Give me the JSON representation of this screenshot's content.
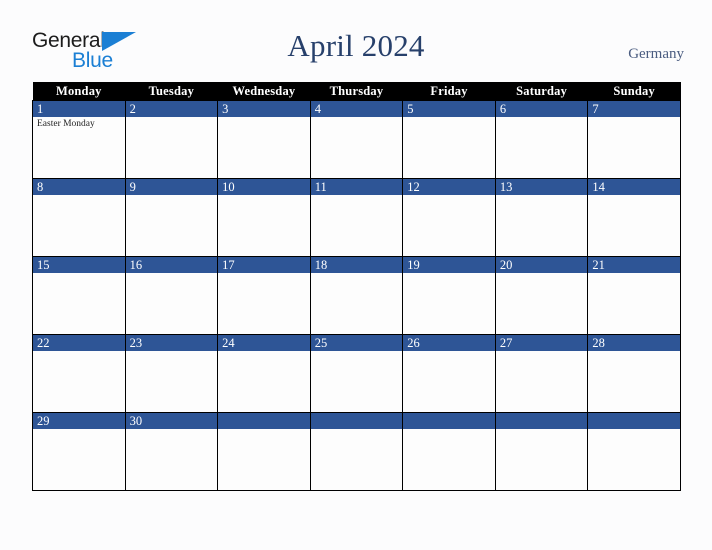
{
  "brand": {
    "name_part1": "General",
    "name_part2": "Blue",
    "color_dark": "#1c1c1c",
    "color_blue": "#1b7fd4"
  },
  "header": {
    "title": "April 2024",
    "region": "Germany",
    "title_color": "#27406b",
    "region_color": "#4a5c80"
  },
  "calendar": {
    "month": "April",
    "year": "2024",
    "country": "Germany",
    "weekday_headers": [
      "Monday",
      "Tuesday",
      "Wednesday",
      "Thursday",
      "Friday",
      "Saturday",
      "Sunday"
    ],
    "header_bg": "#000000",
    "header_text_color": "#ffffff",
    "date_band_color": "#2e5596",
    "date_text_color": "#ffffff",
    "cell_bg": "#fdfdfd",
    "cell_border_color": "#000000",
    "weeks": [
      {
        "days": [
          {
            "date": "1",
            "events": [
              "Easter Monday"
            ]
          },
          {
            "date": "2",
            "events": []
          },
          {
            "date": "3",
            "events": []
          },
          {
            "date": "4",
            "events": []
          },
          {
            "date": "5",
            "events": []
          },
          {
            "date": "6",
            "events": []
          },
          {
            "date": "7",
            "events": []
          }
        ]
      },
      {
        "days": [
          {
            "date": "8",
            "events": []
          },
          {
            "date": "9",
            "events": []
          },
          {
            "date": "10",
            "events": []
          },
          {
            "date": "11",
            "events": []
          },
          {
            "date": "12",
            "events": []
          },
          {
            "date": "13",
            "events": []
          },
          {
            "date": "14",
            "events": []
          }
        ]
      },
      {
        "days": [
          {
            "date": "15",
            "events": []
          },
          {
            "date": "16",
            "events": []
          },
          {
            "date": "17",
            "events": []
          },
          {
            "date": "18",
            "events": []
          },
          {
            "date": "19",
            "events": []
          },
          {
            "date": "20",
            "events": []
          },
          {
            "date": "21",
            "events": []
          }
        ]
      },
      {
        "days": [
          {
            "date": "22",
            "events": []
          },
          {
            "date": "23",
            "events": []
          },
          {
            "date": "24",
            "events": []
          },
          {
            "date": "25",
            "events": []
          },
          {
            "date": "26",
            "events": []
          },
          {
            "date": "27",
            "events": []
          },
          {
            "date": "28",
            "events": []
          }
        ]
      },
      {
        "days": [
          {
            "date": "29",
            "events": []
          },
          {
            "date": "30",
            "events": []
          },
          {
            "date": "",
            "events": []
          },
          {
            "date": "",
            "events": []
          },
          {
            "date": "",
            "events": []
          },
          {
            "date": "",
            "events": []
          },
          {
            "date": "",
            "events": []
          }
        ]
      }
    ]
  }
}
